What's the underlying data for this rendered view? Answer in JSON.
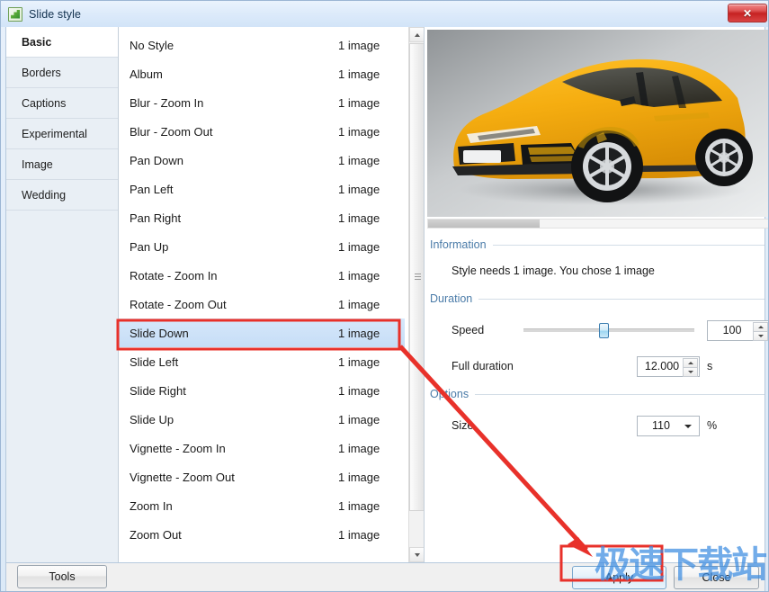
{
  "window": {
    "title": "Slide style",
    "icon": "chart-green-icon",
    "close_label": "✕"
  },
  "sidebar": {
    "items": [
      {
        "label": "Basic",
        "active": true
      },
      {
        "label": "Borders",
        "active": false
      },
      {
        "label": "Captions",
        "active": false
      },
      {
        "label": "Experimental",
        "active": false
      },
      {
        "label": "Image",
        "active": false
      },
      {
        "label": "Wedding",
        "active": false
      }
    ]
  },
  "style_list": {
    "rows": [
      {
        "name": "No Style",
        "count": "1 image",
        "selected": false
      },
      {
        "name": "Album",
        "count": "1 image",
        "selected": false
      },
      {
        "name": "Blur - Zoom In",
        "count": "1 image",
        "selected": false
      },
      {
        "name": "Blur - Zoom Out",
        "count": "1 image",
        "selected": false
      },
      {
        "name": "Pan Down",
        "count": "1 image",
        "selected": false
      },
      {
        "name": "Pan Left",
        "count": "1 image",
        "selected": false
      },
      {
        "name": "Pan Right",
        "count": "1 image",
        "selected": false
      },
      {
        "name": "Pan Up",
        "count": "1 image",
        "selected": false
      },
      {
        "name": "Rotate - Zoom In",
        "count": "1 image",
        "selected": false
      },
      {
        "name": "Rotate - Zoom Out",
        "count": "1 image",
        "selected": false
      },
      {
        "name": "Slide Down",
        "count": "1 image",
        "selected": true
      },
      {
        "name": "Slide Left",
        "count": "1 image",
        "selected": false
      },
      {
        "name": "Slide Right",
        "count": "1 image",
        "selected": false
      },
      {
        "name": "Slide Up",
        "count": "1 image",
        "selected": false
      },
      {
        "name": "Vignette - Zoom In",
        "count": "1 image",
        "selected": false
      },
      {
        "name": "Vignette - Zoom Out",
        "count": "1 image",
        "selected": false
      },
      {
        "name": "Zoom In",
        "count": "1 image",
        "selected": false
      },
      {
        "name": "Zoom Out",
        "count": "1 image",
        "selected": false
      }
    ]
  },
  "preview": {
    "alt": "yellow Lamborghini Urus SUV on grey studio background"
  },
  "information": {
    "title": "Information",
    "text": "Style needs 1 image. You chose 1 image"
  },
  "duration": {
    "title": "Duration",
    "speed_label": "Speed",
    "speed_value": "100",
    "speed_unit": "%",
    "speed_slider_percent": 47,
    "full_duration_label": "Full duration",
    "full_duration_value": "12.000",
    "full_duration_unit": "s"
  },
  "options": {
    "title": "Options",
    "size_label": "Size",
    "size_value": "110",
    "size_unit": "%"
  },
  "footer": {
    "tools_label": "Tools",
    "apply_label": "Apply",
    "close_label": "Close"
  },
  "annotations": {
    "watermark": "极速下载站",
    "highlight_color": "#e8312a"
  }
}
